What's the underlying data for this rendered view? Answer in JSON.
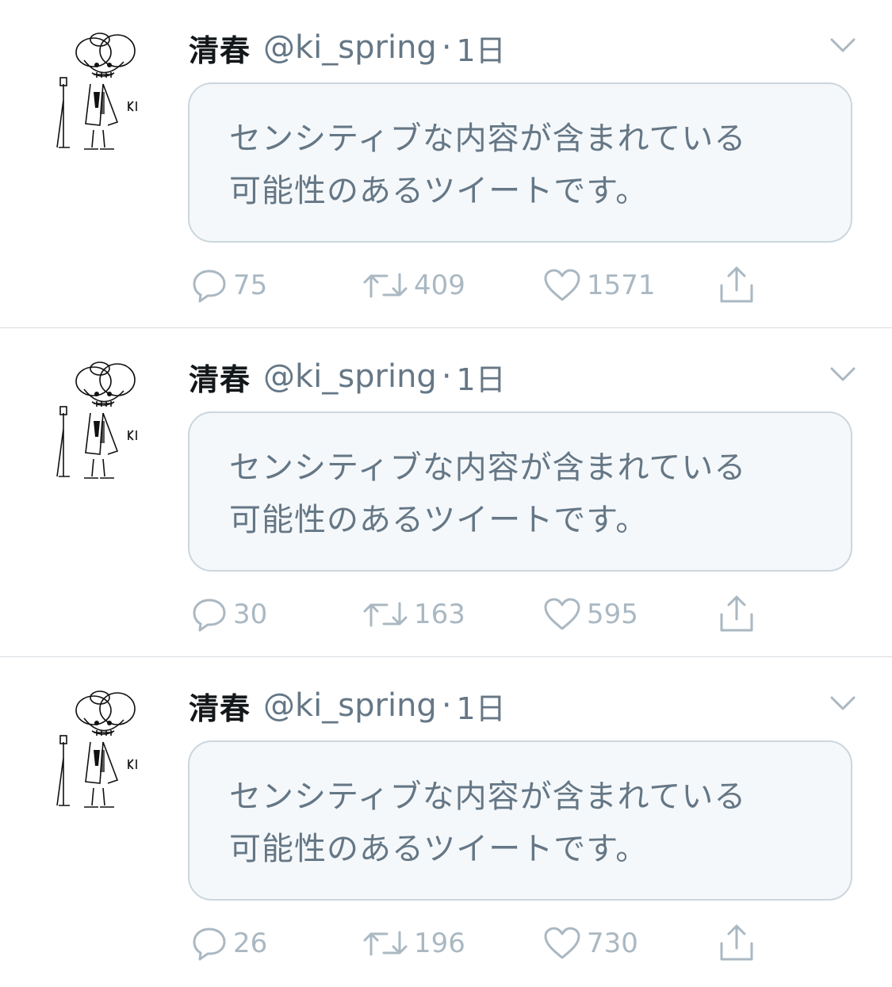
{
  "tweets": [
    {
      "display_name": "清春",
      "handle": "@ki_spring",
      "separator": "·",
      "time": "1日",
      "sensitive_line1": "センシティブな内容が含まれている",
      "sensitive_line2": "可能性のあるツイートです。",
      "replies": "75",
      "retweets": "409",
      "likes": "1571"
    },
    {
      "display_name": "清春",
      "handle": "@ki_spring",
      "separator": "·",
      "time": "1日",
      "sensitive_line1": "センシティブな内容が含まれている",
      "sensitive_line2": "可能性のあるツイートです。",
      "replies": "30",
      "retweets": "163",
      "likes": "595"
    },
    {
      "display_name": "清春",
      "handle": "@ki_spring",
      "separator": "·",
      "time": "1日",
      "sensitive_line1": "センシティブな内容が含まれている",
      "sensitive_line2": "可能性のあるツイートです。",
      "replies": "26",
      "retweets": "196",
      "likes": "730"
    }
  ],
  "colors": {
    "name": "#14171a",
    "secondary": "#657786",
    "icon_gray": "#aab8c2",
    "box_bg": "#f5f8fa",
    "box_border": "#ccd6dd",
    "divider": "#d8dde2"
  },
  "icons": {
    "avatar": "sketch-avatar",
    "caret": "chevron-down-icon",
    "reply": "reply-bubble-icon",
    "retweet": "retweet-icon",
    "like": "heart-icon",
    "share": "share-icon"
  }
}
